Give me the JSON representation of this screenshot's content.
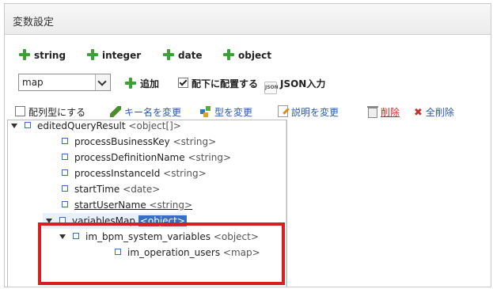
{
  "window": {
    "title": "変数設定"
  },
  "type_buttons": [
    {
      "label": "string"
    },
    {
      "label": "integer"
    },
    {
      "label": "date"
    },
    {
      "label": "object"
    }
  ],
  "controls": {
    "select_value": "map",
    "add_label": "追加",
    "place_under_label": "配下に配置する",
    "place_under_checked": true,
    "json_icon": "JSON",
    "json_label": "JSON入力"
  },
  "actions": {
    "array_label": "配列型にする",
    "rename_key": "キー名を変更",
    "change_type": "型を変更",
    "change_desc": "説明を変更",
    "delete": "削除",
    "delete_all": "全削除"
  },
  "tree": [
    {
      "name": "editedQueryResult",
      "type": "<object[]>",
      "level": 0,
      "expanded": true
    },
    {
      "name": "processBusinessKey",
      "type": "<string>",
      "level": 1
    },
    {
      "name": "processDefinitionName",
      "type": "<string>",
      "level": 1
    },
    {
      "name": "processInstanceId",
      "type": "<string>",
      "level": 1
    },
    {
      "name": "startTime",
      "type": "<date>",
      "level": 1
    },
    {
      "name": "startUserName",
      "type": "<string>",
      "level": 1
    },
    {
      "name": "variablesMap",
      "type": "<object>",
      "level": 0,
      "expanded": true,
      "selected": true
    },
    {
      "name": "im_bpm_system_variables",
      "type": "<object>",
      "level": 1,
      "expanded": true
    },
    {
      "name": "im_operation_users",
      "type": "<map>",
      "level": 2
    }
  ],
  "colors": {
    "accent_green": "#3aa335",
    "link_blue": "#2c5aa8",
    "delete_red": "#cc2b2b",
    "highlight_red": "#d61f1f"
  }
}
